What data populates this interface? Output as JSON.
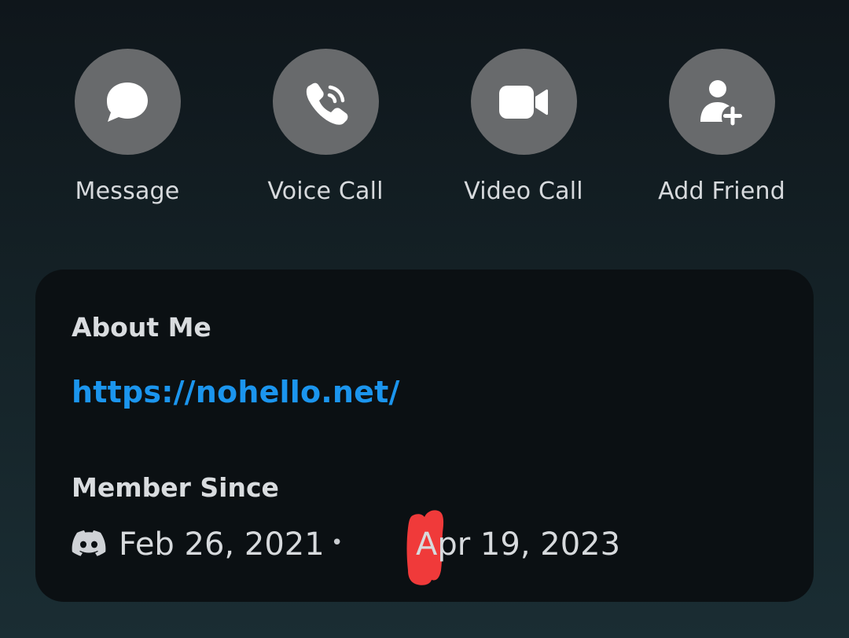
{
  "actions": [
    {
      "label": "Message",
      "icon": "chat-bubble-icon"
    },
    {
      "label": "Voice Call",
      "icon": "phone-call-icon"
    },
    {
      "label": "Video Call",
      "icon": "video-camera-icon"
    },
    {
      "label": "Add Friend",
      "icon": "add-friend-icon"
    }
  ],
  "about": {
    "title": "About Me",
    "link": "https://nohello.net/"
  },
  "member": {
    "title": "Member Since",
    "discord_date": "Feb 26, 2021",
    "separator": "•",
    "server_date": "Apr 19, 2023"
  },
  "colors": {
    "link": "#1b95ee",
    "button_circle": "#686a6c",
    "card": "#0b1013",
    "redaction": "#f03a3a"
  }
}
